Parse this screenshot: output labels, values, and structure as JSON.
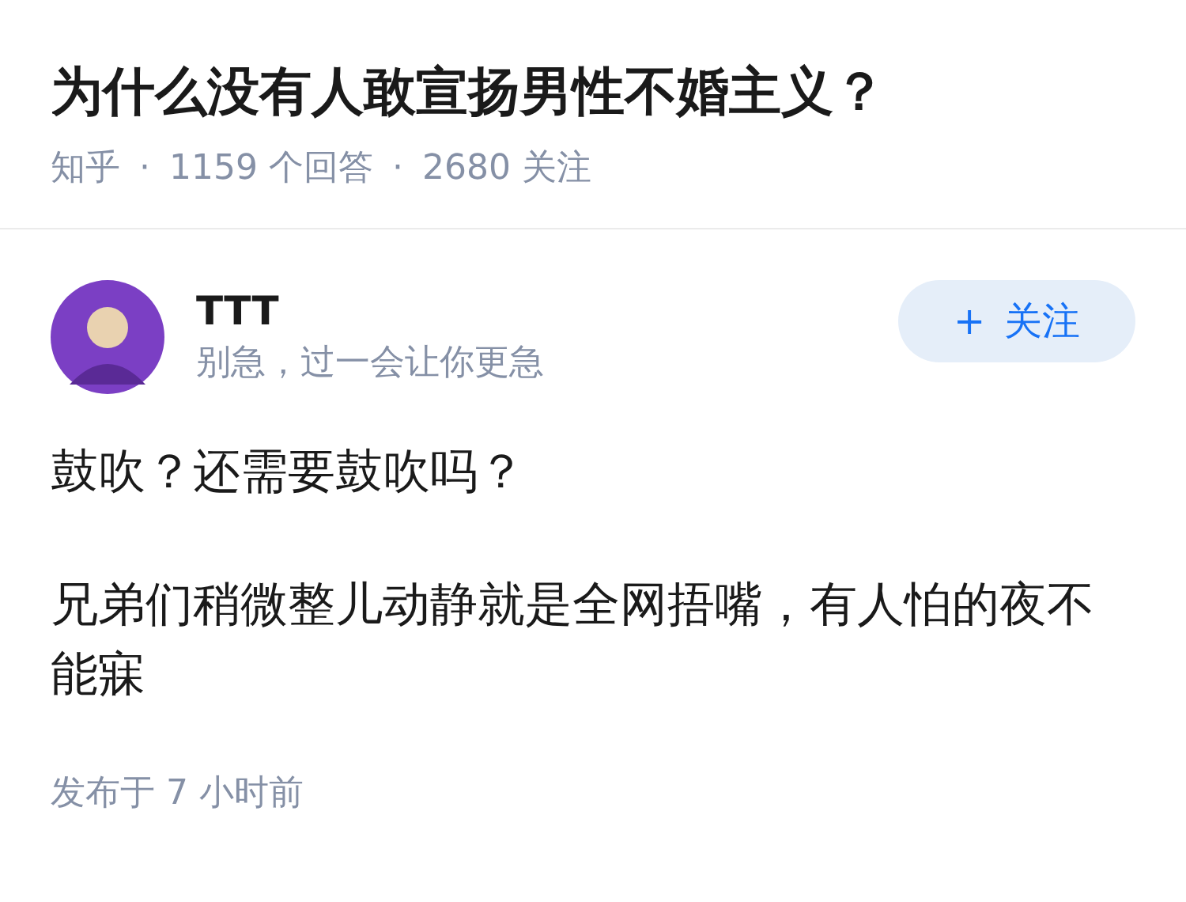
{
  "question": {
    "title": "为什么没有人敢宣扬男性不婚主义？",
    "meta": [
      "知乎",
      "·",
      "1159 个回答",
      "·",
      "2680 关注"
    ]
  },
  "answer": {
    "author": {
      "name": "TTT",
      "bio": "别急，过一会让你更急"
    },
    "follow_button": {
      "icon": "+",
      "label": "关注"
    },
    "paragraphs": [
      "鼓吹？还需要鼓吹吗？",
      "兄弟们稍微整儿动静就是全网捂嘴，有人怕的夜不能寐"
    ],
    "published": "发布于 7 小时前"
  }
}
